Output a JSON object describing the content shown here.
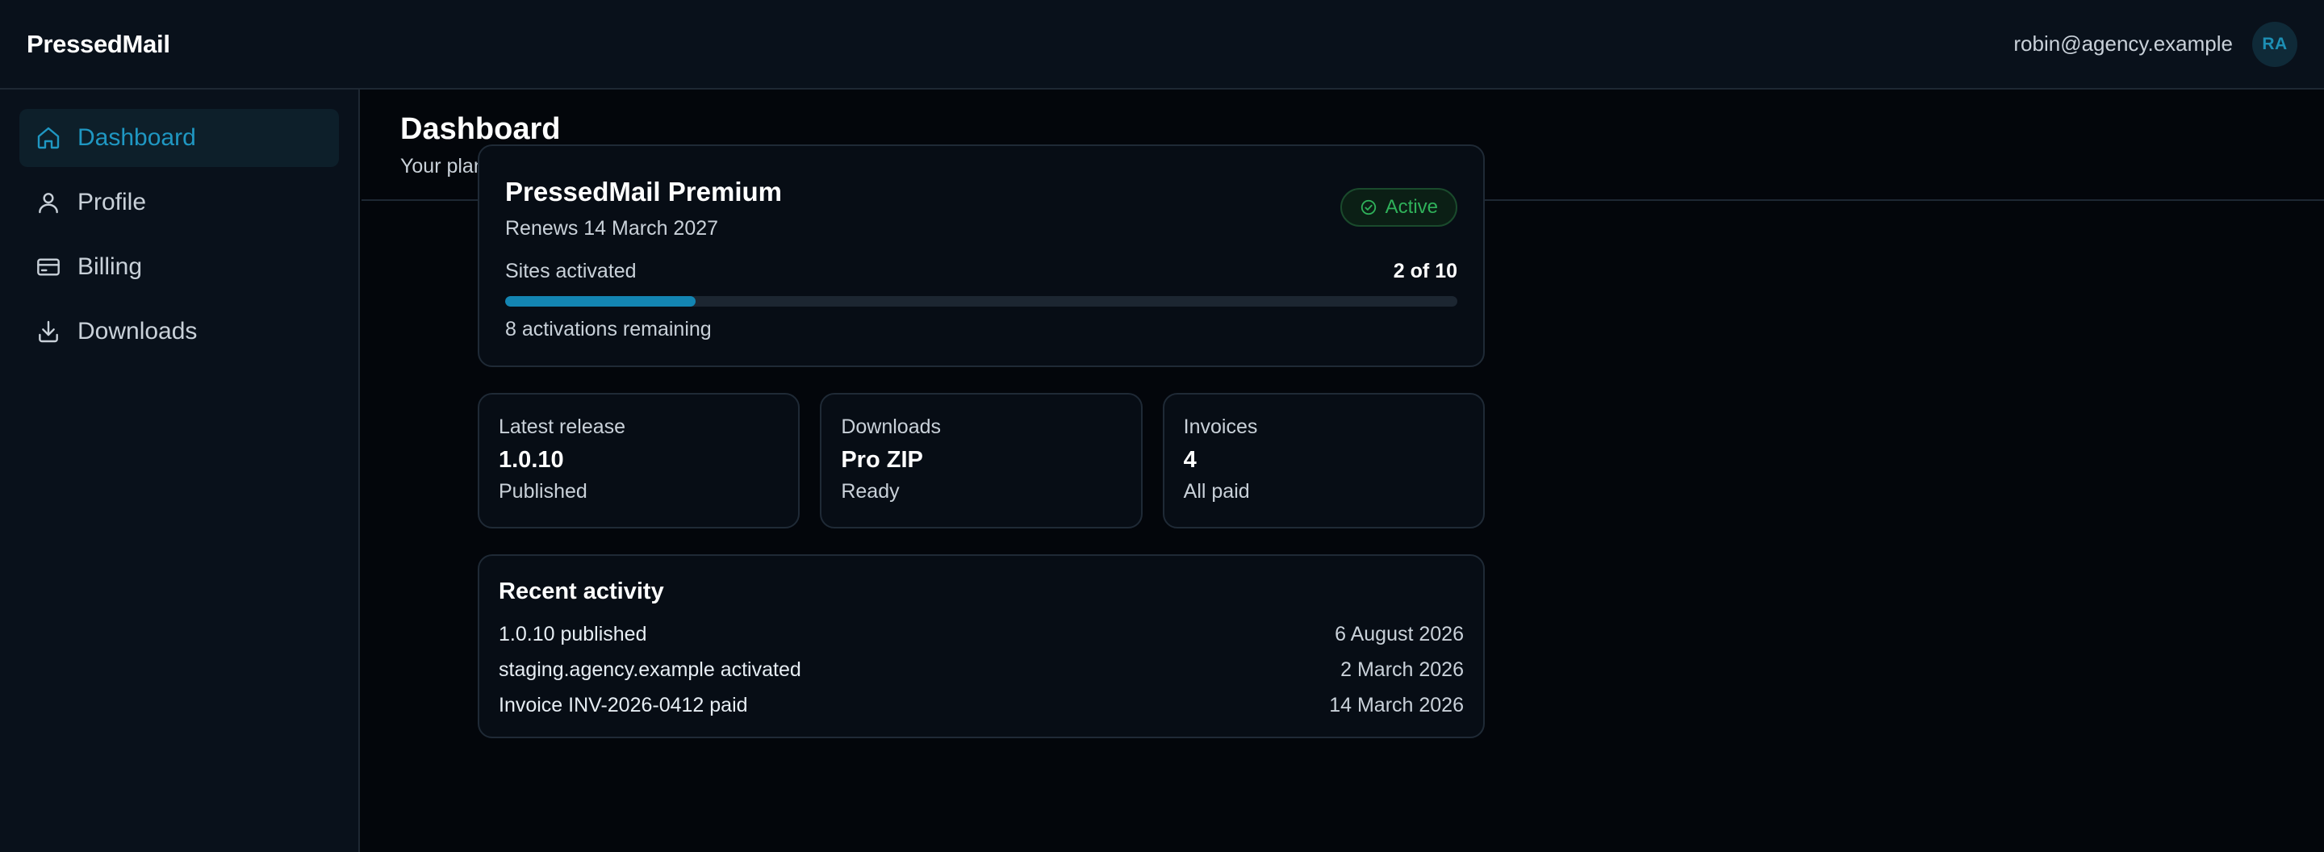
{
  "app": {
    "brand": "PressedMail"
  },
  "user": {
    "email": "robin@agency.example",
    "initials": "RA"
  },
  "sidebar": {
    "items": [
      {
        "label": "Dashboard",
        "icon": "home-icon",
        "active": true
      },
      {
        "label": "Profile",
        "icon": "user-icon",
        "active": false
      },
      {
        "label": "Billing",
        "icon": "credit-card-icon",
        "active": false
      },
      {
        "label": "Downloads",
        "icon": "download-icon",
        "active": false
      }
    ]
  },
  "page": {
    "title": "Dashboard",
    "subtitle": "Your plan, your sites and what has changed."
  },
  "plan": {
    "name": "PressedMail Premium",
    "renews": "Renews 14 March 2027",
    "status": "Active",
    "sites_label": "Sites activated",
    "sites_value": "2 of 10",
    "sites_used": 2,
    "sites_total": 10,
    "remaining": "8 activations remaining"
  },
  "stats": [
    {
      "label": "Latest release",
      "value": "1.0.10",
      "sub": "Published"
    },
    {
      "label": "Downloads",
      "value": "Pro ZIP",
      "sub": "Ready"
    },
    {
      "label": "Invoices",
      "value": "4",
      "sub": "All paid"
    }
  ],
  "activity": {
    "title": "Recent activity",
    "rows": [
      {
        "text": "1.0.10 published",
        "date": "6 August 2026"
      },
      {
        "text": "staging.agency.example activated",
        "date": "2 March 2026"
      },
      {
        "text": "Invoice INV-2026-0412 paid",
        "date": "14 March 2026"
      }
    ]
  },
  "colors": {
    "accent": "#1f97c2",
    "success": "#2fb15a",
    "background": "#03060b",
    "surface": "#09111b"
  }
}
